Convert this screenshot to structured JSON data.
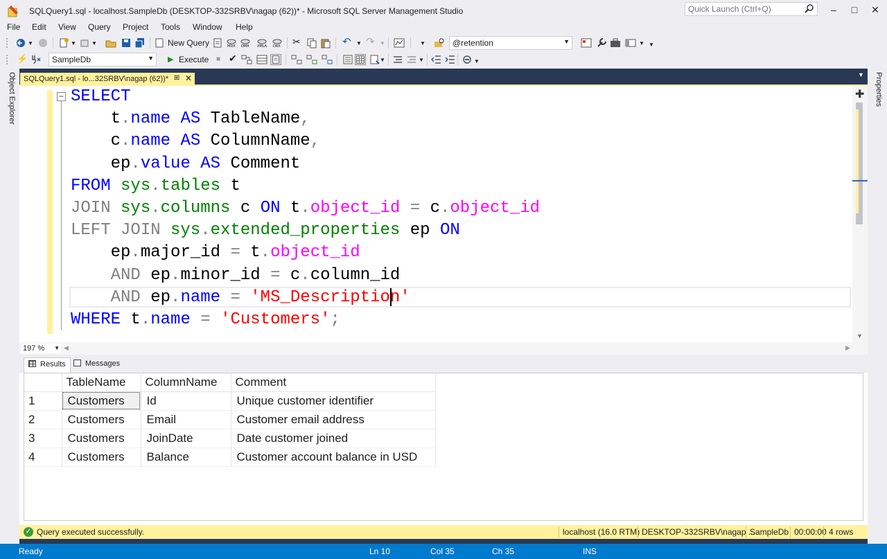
{
  "window": {
    "title": "SQLQuery1.sql - localhost.SampleDb (DESKTOP-332SRBV\\nagap (62))* - Microsoft SQL Server Management Studio",
    "quick_launch_placeholder": "Quick Launch (Ctrl+Q)"
  },
  "menu": [
    "File",
    "Edit",
    "View",
    "Query",
    "Project",
    "Tools",
    "Window",
    "Help"
  ],
  "toolbar": {
    "new_query_label": "New Query",
    "search_combo_value": "@retention",
    "database_combo_value": "SampleDb",
    "execute_label": "Execute"
  },
  "side_tabs": {
    "left": "Object Explorer",
    "right": "Properties"
  },
  "document_tab": {
    "label": "SQLQuery1.sql - lo...32SRBV\\nagap (62))*"
  },
  "editor": {
    "zoom": "197 %",
    "cursor": {
      "line": 10,
      "col": 35,
      "ch": 35
    }
  },
  "results": {
    "tabs": [
      "Results",
      "Messages"
    ],
    "columns": [
      "TableName",
      "ColumnName",
      "Comment"
    ],
    "rows": [
      [
        "1",
        "Customers",
        "Id",
        "Unique customer identifier"
      ],
      [
        "2",
        "Customers",
        "Email",
        "Customer email address"
      ],
      [
        "3",
        "Customers",
        "JoinDate",
        "Date customer joined"
      ],
      [
        "4",
        "Customers",
        "Balance",
        "Customer account balance in USD"
      ]
    ]
  },
  "query_status": {
    "message": "Query executed successfully.",
    "server": "localhost (16.0 RTM)",
    "user": "DESKTOP-332SRBV\\nagap ...",
    "database": "SampleDb",
    "elapsed": "00:00:00",
    "rows": "4 rows"
  },
  "statusbar": {
    "state": "Ready",
    "ln": "Ln 10",
    "col": "Col 35",
    "ch": "Ch 35",
    "mode": "INS"
  },
  "colors": {
    "keyword": "#0000ff",
    "system_object": "#008000",
    "function": "#ff00ff",
    "string": "#ff0000",
    "gray_keyword": "#808080",
    "status_bar": "#007acc",
    "tab_yellow": "#fff29d"
  }
}
